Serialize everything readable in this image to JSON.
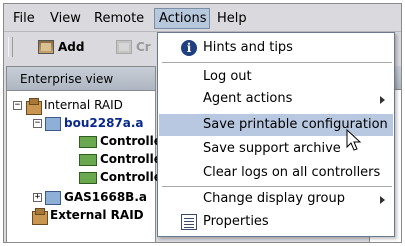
{
  "menubar": {
    "items": [
      {
        "label": "File"
      },
      {
        "label": "View"
      },
      {
        "label": "Remote"
      },
      {
        "label": "Actions"
      },
      {
        "label": "Help"
      }
    ]
  },
  "toolbar": {
    "add_label": "Add",
    "create_label": "Cr"
  },
  "left_panel": {
    "title": "Enterprise view",
    "tree": [
      {
        "label": "Internal RAID",
        "expander": "−"
      },
      {
        "label": "bou2287a.a",
        "expander": "−"
      },
      {
        "label": "Controlle"
      },
      {
        "label": "Controlle"
      },
      {
        "label": "Controlle"
      },
      {
        "label": "GAS1668B.a",
        "expander": "+"
      },
      {
        "label": "External RAID"
      }
    ]
  },
  "actions_menu": {
    "items": [
      {
        "label": "Hints and tips",
        "icon": "info-icon"
      },
      {
        "label": "Log out"
      },
      {
        "label": "Agent actions",
        "submenu": true
      },
      {
        "label": "Save printable configuration",
        "highlighted": true
      },
      {
        "label": "Save support archive"
      },
      {
        "label": "Clear logs on all controllers"
      },
      {
        "label": "Change display group",
        "submenu": true
      },
      {
        "label": "Properties",
        "icon": "properties-icon"
      }
    ]
  },
  "colors": {
    "highlight": "#b8c8e0",
    "menubar_bg": "#d9d9de",
    "tree_selected_text": "#0a2a8a"
  }
}
